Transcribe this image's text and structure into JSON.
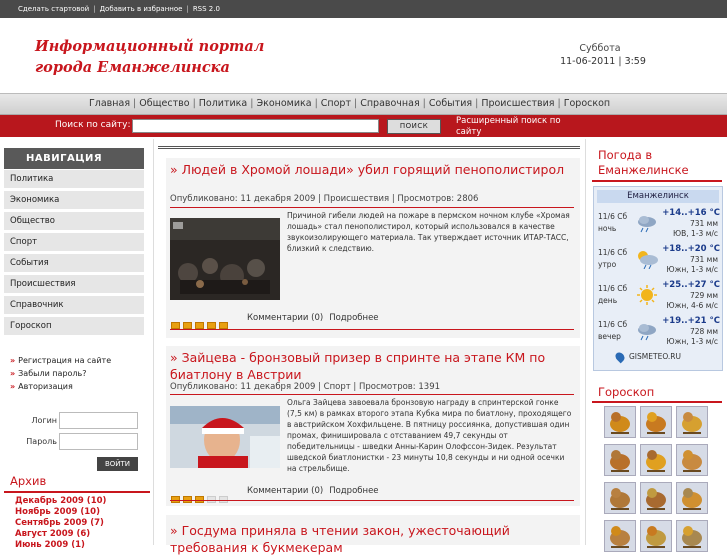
{
  "topbar": {
    "links": [
      "Сделать стартовой",
      "Добавить в избранное",
      "RSS 2.0"
    ]
  },
  "header": {
    "title_line1": "Информационный портал",
    "title_line2": "города Еманжелинска",
    "day": "Суббота",
    "date": "11-06-2011",
    "time": "3:59"
  },
  "nav": {
    "items": [
      "Главная",
      "Общество",
      "Политика",
      "Экономика",
      "Спорт",
      "Справочная",
      "События",
      "Происшествия",
      "Гороскоп"
    ]
  },
  "search": {
    "label": "Поиск по сайту:",
    "value": "",
    "button": "ПОИСК",
    "advanced": "Расширенный поиск по сайту"
  },
  "sidebar": {
    "title": "НАВИГАЦИЯ",
    "items": [
      "Политика",
      "Экономика",
      "Общество",
      "Спорт",
      "События",
      "Происшествия",
      "Справочник",
      "Гороскоп"
    ],
    "links": [
      "Регистрация на сайте",
      "Забыли пароль?",
      "Авторизация"
    ],
    "login_label": "Логин",
    "password_label": "Пароль",
    "login_button": "ВОЙТИ",
    "archive_title": "Архив",
    "archive": [
      "Декабрь 2009 (10)",
      "Ноябрь 2009 (10)",
      "Сентябрь 2009 (7)",
      "Август 2009 (6)",
      "Июнь 2009 (1)"
    ]
  },
  "articles": [
    {
      "title": "»    Людей в   Хромой лошади» убил горящий пенополистирол",
      "meta": "Опубликовано: 11 декабря 2009 | Происшествия | Просмотров: 2806",
      "text": "Причиной гибели людей на пожаре в пермском ночном клубе «Хромая лошадь» стал пенополистирол, который использовался в качестве звукоизолирующего материала. Так утверждает источник ИТАР-ТАСС, близкий к следствию.",
      "rating": 5,
      "comments": "Комментарии (0)",
      "more": "Подробнее"
    },
    {
      "title": "» Зайцева  - бронзовый призер в спринте на этапе КМ по биатлону в Австрии",
      "meta": "Опубликовано: 11 декабря 2009 | Спорт | Просмотров: 1391",
      "text": "Ольга Зайцева завоевала бронзовую награду в спринтерской гонке (7,5 км) в рамках второго этапа Кубка мира по биатлону, проходящего в австрийском Хохфильцене. В пятницу россиянка, допустившая один промах, финишировала с отставанием 49,7 секунды от победительницы - шведки Анны-Карин Олофссон-Зидек. Результат шведской биатлонистки - 23 минуты 10,8 секунды и ни одной осечки на стрельбище.",
      "rating": 3,
      "comments": "Комментарии (0)",
      "more": "Подробнее"
    },
    {
      "title": "»  Госдума приняла в   чтении закон, ужесточающий требования к букмекерам"
    }
  ],
  "weather": {
    "title": "Погода в Еманжелинске",
    "city": "Еманжелинск",
    "rows": [
      {
        "date": "11/6 Сб",
        "part": "ночь",
        "icon": "cloud-rain-icon",
        "temp": "+14..+16 °C",
        "pressure": "731 мм",
        "wind": "ЮВ, 1-3 м/с"
      },
      {
        "date": "11/6 Сб",
        "part": "утро",
        "icon": "sun-cloud-rain-icon",
        "temp": "+18..+20 °C",
        "pressure": "731 мм",
        "wind": "Южн, 1-3 м/с"
      },
      {
        "date": "11/6 Сб",
        "part": "день",
        "icon": "sun-icon",
        "temp": "+25..+27 °C",
        "pressure": "729 мм",
        "wind": "Южн, 4-6 м/с"
      },
      {
        "date": "11/6 Сб",
        "part": "вечер",
        "icon": "cloud-rain-icon",
        "temp": "+19..+21 °C",
        "pressure": "728 мм",
        "wind": "Южн, 1-3 м/с"
      }
    ],
    "source": "GISMETEO.RU"
  },
  "horoscope": {
    "title": "Гороскоп",
    "signs": [
      "aries-icon",
      "taurus-icon",
      "gemini-icon",
      "cancer-icon",
      "leo-icon",
      "virgo-icon",
      "libra-icon",
      "scorpio-icon",
      "sagittarius-icon",
      "capricorn-icon",
      "aquarius-icon",
      "pisces-icon"
    ]
  },
  "colors": {
    "accent": "#c8161d",
    "topbar": "#4a4a4a",
    "nav_bg": "#dcdcdc"
  }
}
